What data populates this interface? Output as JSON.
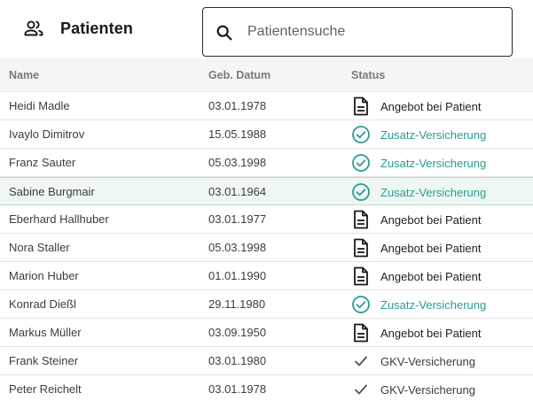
{
  "header": {
    "title": "Patienten",
    "icon": "users-icon"
  },
  "search": {
    "placeholder": "Patientensuche",
    "value": "",
    "icon": "search-icon"
  },
  "table": {
    "columns": {
      "name": "Name",
      "dob": "Geb. Datum",
      "status": "Status"
    },
    "status_colors": {
      "zusatz": "#2a9d8f",
      "angebot": "#1f1f1f",
      "gkv": "#3d3d3d"
    },
    "rows": [
      {
        "name": "Heidi Madle",
        "dob": "03.01.1978",
        "status": "Angebot bei Patient",
        "status_type": "angebot",
        "icon": "document-icon",
        "selected": false
      },
      {
        "name": "Ivaylo Dimitrov",
        "dob": "15.05.1988",
        "status": "Zusatz-Versicherung",
        "status_type": "zusatz",
        "icon": "check-circle-icon",
        "selected": false
      },
      {
        "name": "Franz Sauter",
        "dob": "05.03.1998",
        "status": "Zusatz-Versicherung",
        "status_type": "zusatz",
        "icon": "check-circle-icon",
        "selected": false
      },
      {
        "name": "Sabine Burgmair",
        "dob": "03.01.1964",
        "status": "Zusatz-Versicherung",
        "status_type": "zusatz",
        "icon": "check-circle-icon",
        "selected": true
      },
      {
        "name": "Eberhard Hallhuber",
        "dob": "03.01.1977",
        "status": "Angebot bei Patient",
        "status_type": "angebot",
        "icon": "document-icon",
        "selected": false
      },
      {
        "name": "Nora Staller",
        "dob": "05.03.1998",
        "status": "Angebot bei Patient",
        "status_type": "angebot",
        "icon": "document-icon",
        "selected": false
      },
      {
        "name": "Marion Huber",
        "dob": "01.01.1990",
        "status": "Angebot bei Patient",
        "status_type": "angebot",
        "icon": "document-icon",
        "selected": false
      },
      {
        "name": "Konrad Dießl",
        "dob": "29.11.1980",
        "status": "Zusatz-Versicherung",
        "status_type": "zusatz",
        "icon": "check-circle-icon",
        "selected": false
      },
      {
        "name": "Markus Müller",
        "dob": "03.09.1950",
        "status": "Angebot bei Patient",
        "status_type": "angebot",
        "icon": "document-icon",
        "selected": false
      },
      {
        "name": "Frank Steiner",
        "dob": "03.01.1980",
        "status": "GKV-Versicherung",
        "status_type": "gkv",
        "icon": "check-icon",
        "selected": false
      },
      {
        "name": "Peter Reichelt",
        "dob": "03.01.1978",
        "status": "GKV-Versicherung",
        "status_type": "gkv",
        "icon": "check-icon",
        "selected": false
      }
    ]
  }
}
